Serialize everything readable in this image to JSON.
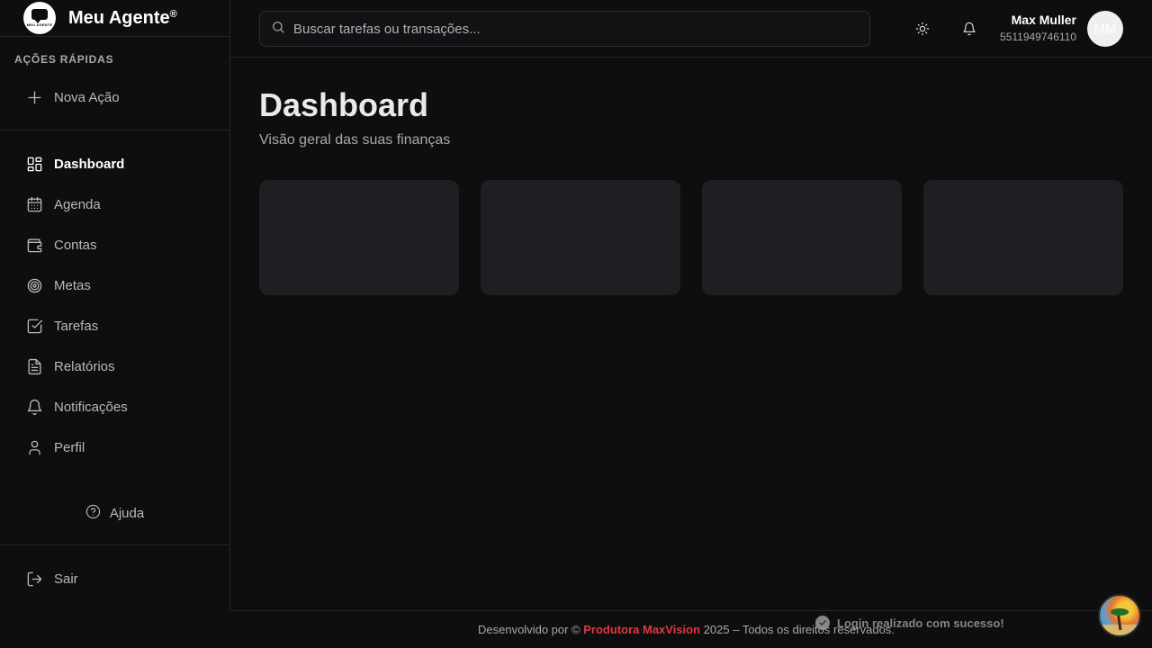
{
  "brand": {
    "name": "Meu Agente",
    "trademark": "®",
    "logo_text": "MEU AGENTE"
  },
  "sidebar": {
    "quick_actions_title": "AÇÕES RÁPIDAS",
    "new_action_label": "Nova Ação",
    "items": [
      {
        "label": "Dashboard",
        "icon": "layout-grid-icon",
        "active": true
      },
      {
        "label": "Agenda",
        "icon": "calendar-icon",
        "active": false
      },
      {
        "label": "Contas",
        "icon": "wallet-icon",
        "active": false
      },
      {
        "label": "Metas",
        "icon": "target-icon",
        "active": false
      },
      {
        "label": "Tarefas",
        "icon": "checkbox-icon",
        "active": false
      },
      {
        "label": "Relatórios",
        "icon": "file-text-icon",
        "active": false
      },
      {
        "label": "Notificações",
        "icon": "bell-icon",
        "active": false
      },
      {
        "label": "Perfil",
        "icon": "user-icon",
        "active": false
      }
    ],
    "help_label": "Ajuda",
    "logout_label": "Sair"
  },
  "header": {
    "search_placeholder": "Buscar tarefas ou transações...",
    "user_name": "Max Muller",
    "user_phone": "5511949746110",
    "avatar_initials": "MM"
  },
  "main": {
    "title": "Dashboard",
    "subtitle": "Visão geral das suas finanças"
  },
  "footer": {
    "prefix": "Desenvolvido por ©",
    "company": "Produtora MaxVision",
    "suffix": "2025 – Todos os direitos reservados."
  },
  "toast": {
    "message": "Login realizado com sucesso!"
  },
  "colors": {
    "background": "#0e0e0f",
    "card": "#1f1f23",
    "accent_red": "#e0393e",
    "border": "#262628"
  }
}
